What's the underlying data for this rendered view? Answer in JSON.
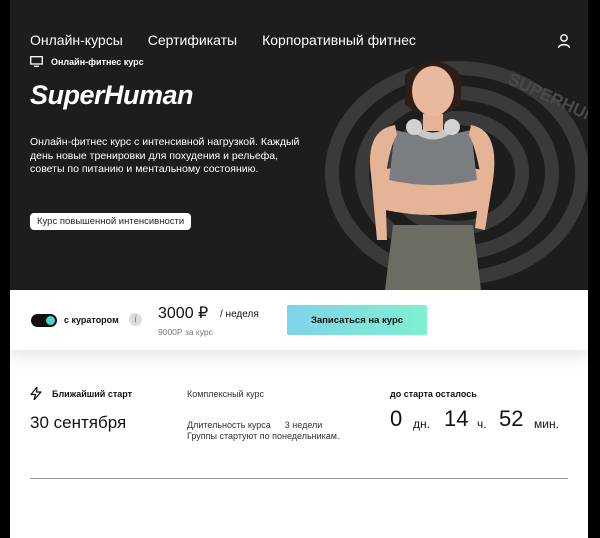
{
  "nav": {
    "items": [
      {
        "label": "Онлайн-курсы"
      },
      {
        "label": "Сертификаты"
      },
      {
        "label": "Корпоративный фитнес"
      }
    ]
  },
  "hero": {
    "course_type": "Онлайн-фитнес курс",
    "brand": "SuperHuman",
    "description": "Онлайн-фитнес курс с интенсивной нагрузкой. Каждый день новые тренировки для похудения и рельефа, советы по питанию и ментальному состоянию.",
    "badge": "Курс повышенной интенсивности",
    "background_word": "SUPERHUMAN"
  },
  "pricing": {
    "curator_label": "с куратором",
    "curator_enabled": true,
    "price": "3000 ₽",
    "period": "/ неделя",
    "full_price": "9000Р за курс",
    "enroll_label": "Записаться на курс"
  },
  "start": {
    "title": "Ближайший старт",
    "date": "30 сентября",
    "program_label": "Комплексный курс",
    "duration_label": "Длительность курса",
    "duration_value": "3 недели",
    "groups_note": "Группы стартуют по понедельникам.",
    "countdown_label": "до старта осталось",
    "days": "0",
    "days_unit": "дн.",
    "hours": "14",
    "hours_unit": "ч.",
    "minutes": "52",
    "minutes_unit": "мин."
  },
  "colors": {
    "hero_bg": "#1d1d1d",
    "toggle_accent": "#4dd4cf",
    "button_gradient_start": "#7fd3e9",
    "button_gradient_end": "#7ff0cf"
  }
}
